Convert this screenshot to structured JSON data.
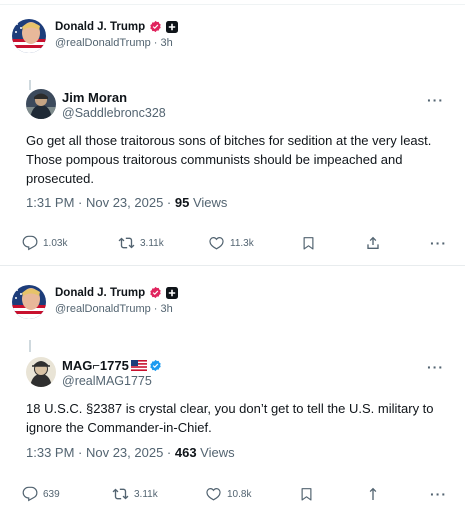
{
  "posts": [
    {
      "author": {
        "name": "Donald J. Trump",
        "handle": "@realDonaldTrump",
        "time": "3h"
      },
      "quoted": {
        "name": "Jim Moran",
        "handle": "@Saddlebronc328",
        "text": "Go get all those traitorous sons of bitches for sedition at the very least.  Those pompous traitorous communists should be impeached and prosecuted.",
        "time": "1:31 PM · Nov 23, 2025 · ",
        "views_count": "95",
        "views_label": " Views",
        "more": "···",
        "actions": {
          "replies": "1.03k",
          "reposts": "3.11k",
          "likes": "11.3k"
        }
      }
    },
    {
      "author": {
        "name": "Donald J. Trump",
        "handle": "@realDonaldTrump",
        "time": "3h"
      },
      "quoted": {
        "name": "MAG⌐1775",
        "handle": "@realMAG1775",
        "text": "18 U.S.C. §2387 is crystal clear, you don’t get to tell the U.S. military to ignore the Commander-in-Chief.",
        "time": "1:33 PM · Nov 23, 2025 · ",
        "views_count": "463",
        "views_label": " Views",
        "more": "···",
        "actions": {
          "replies": "639",
          "reposts": "3.11k",
          "likes": "10.8k"
        }
      }
    }
  ],
  "colors": {
    "text": "#0f1419",
    "muted": "#536471",
    "verified_pink": "#e0245e",
    "verified_blue": "#1d9bf0",
    "border": "#eff3f4"
  },
  "icons": [
    "reply-icon",
    "repost-icon",
    "like-icon",
    "bookmark-icon",
    "share-icon",
    "more-icon",
    "verified-badge-icon",
    "affiliate-badge-icon",
    "us-flag-icon"
  ]
}
